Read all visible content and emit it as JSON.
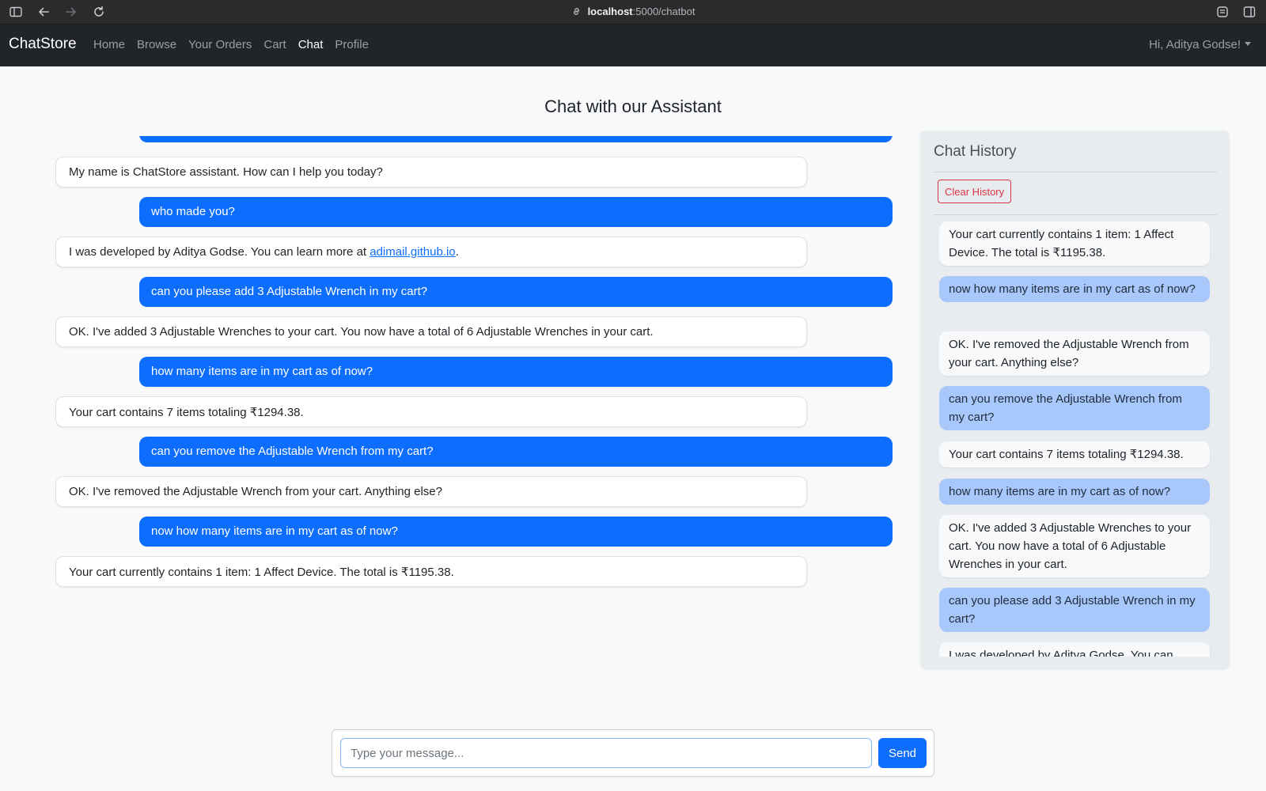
{
  "browser": {
    "url_host": "localhost",
    "url_path": ":5000/chatbot"
  },
  "navbar": {
    "brand": "ChatStore",
    "links": [
      "Home",
      "Browse",
      "Your Orders",
      "Cart",
      "Chat",
      "Profile"
    ],
    "active_link": "Chat",
    "user_greeting": "Hi, Aditya Godse!"
  },
  "page": {
    "title": "Chat with our Assistant"
  },
  "chat": {
    "messages": [
      {
        "role": "bot",
        "text": "My name is ChatStore assistant. How can I help you today?"
      },
      {
        "role": "user",
        "text": "who made you?"
      },
      {
        "role": "bot",
        "text_before": "I was developed by Aditya Godse. You can learn more at ",
        "link": "adimail.github.io",
        "text_after": "."
      },
      {
        "role": "user",
        "text": "can you please add 3 Adjustable Wrench in my cart?"
      },
      {
        "role": "bot",
        "text": "OK. I've added 3 Adjustable Wrenches to your cart. You now have a total of 6 Adjustable Wrenches in your cart."
      },
      {
        "role": "user",
        "text": "how many items are in my cart as of now?"
      },
      {
        "role": "bot",
        "text": "Your cart contains 7 items totaling ₹1294.38."
      },
      {
        "role": "user",
        "text": "can you remove the Adjustable Wrench from my cart?"
      },
      {
        "role": "bot",
        "text": "OK. I've removed the Adjustable Wrench from your cart. Anything else?"
      },
      {
        "role": "user",
        "text": "now how many items are in my cart as of now?"
      },
      {
        "role": "bot",
        "text": "Your cart currently contains 1 item: 1 Affect Device. The total is ₹1195.38."
      }
    ]
  },
  "history": {
    "title": "Chat History",
    "clear_label": "Clear History",
    "items": [
      {
        "role": "bot",
        "text": "Your cart currently contains 1 item: 1 Affect Device. The total is ₹1195.38."
      },
      {
        "role": "user",
        "text": "now how many items are in my cart as of now?"
      },
      {
        "role": "bot",
        "text": "OK. I've removed the Adjustable Wrench from your cart. Anything else?"
      },
      {
        "role": "user",
        "text": "can you remove the Adjustable Wrench from my cart?"
      },
      {
        "role": "bot",
        "text": "Your cart contains 7 items totaling ₹1294.38."
      },
      {
        "role": "user",
        "text": "how many items are in my cart as of now?"
      },
      {
        "role": "bot",
        "text": "OK. I've added 3 Adjustable Wrenches to your cart. You now have a total of 6 Adjustable Wrenches in your cart."
      },
      {
        "role": "user",
        "text": "can you please add 3 Adjustable Wrench in my cart?"
      },
      {
        "role": "bot",
        "text": "I was developed by Aditya Godse. You can"
      }
    ]
  },
  "composer": {
    "placeholder": "Type your message...",
    "send_label": "Send"
  },
  "colors": {
    "primary": "#0d6efd",
    "navbar_bg": "#212529",
    "danger": "#dc3545",
    "history_user_bubble": "#a8c7fa"
  }
}
